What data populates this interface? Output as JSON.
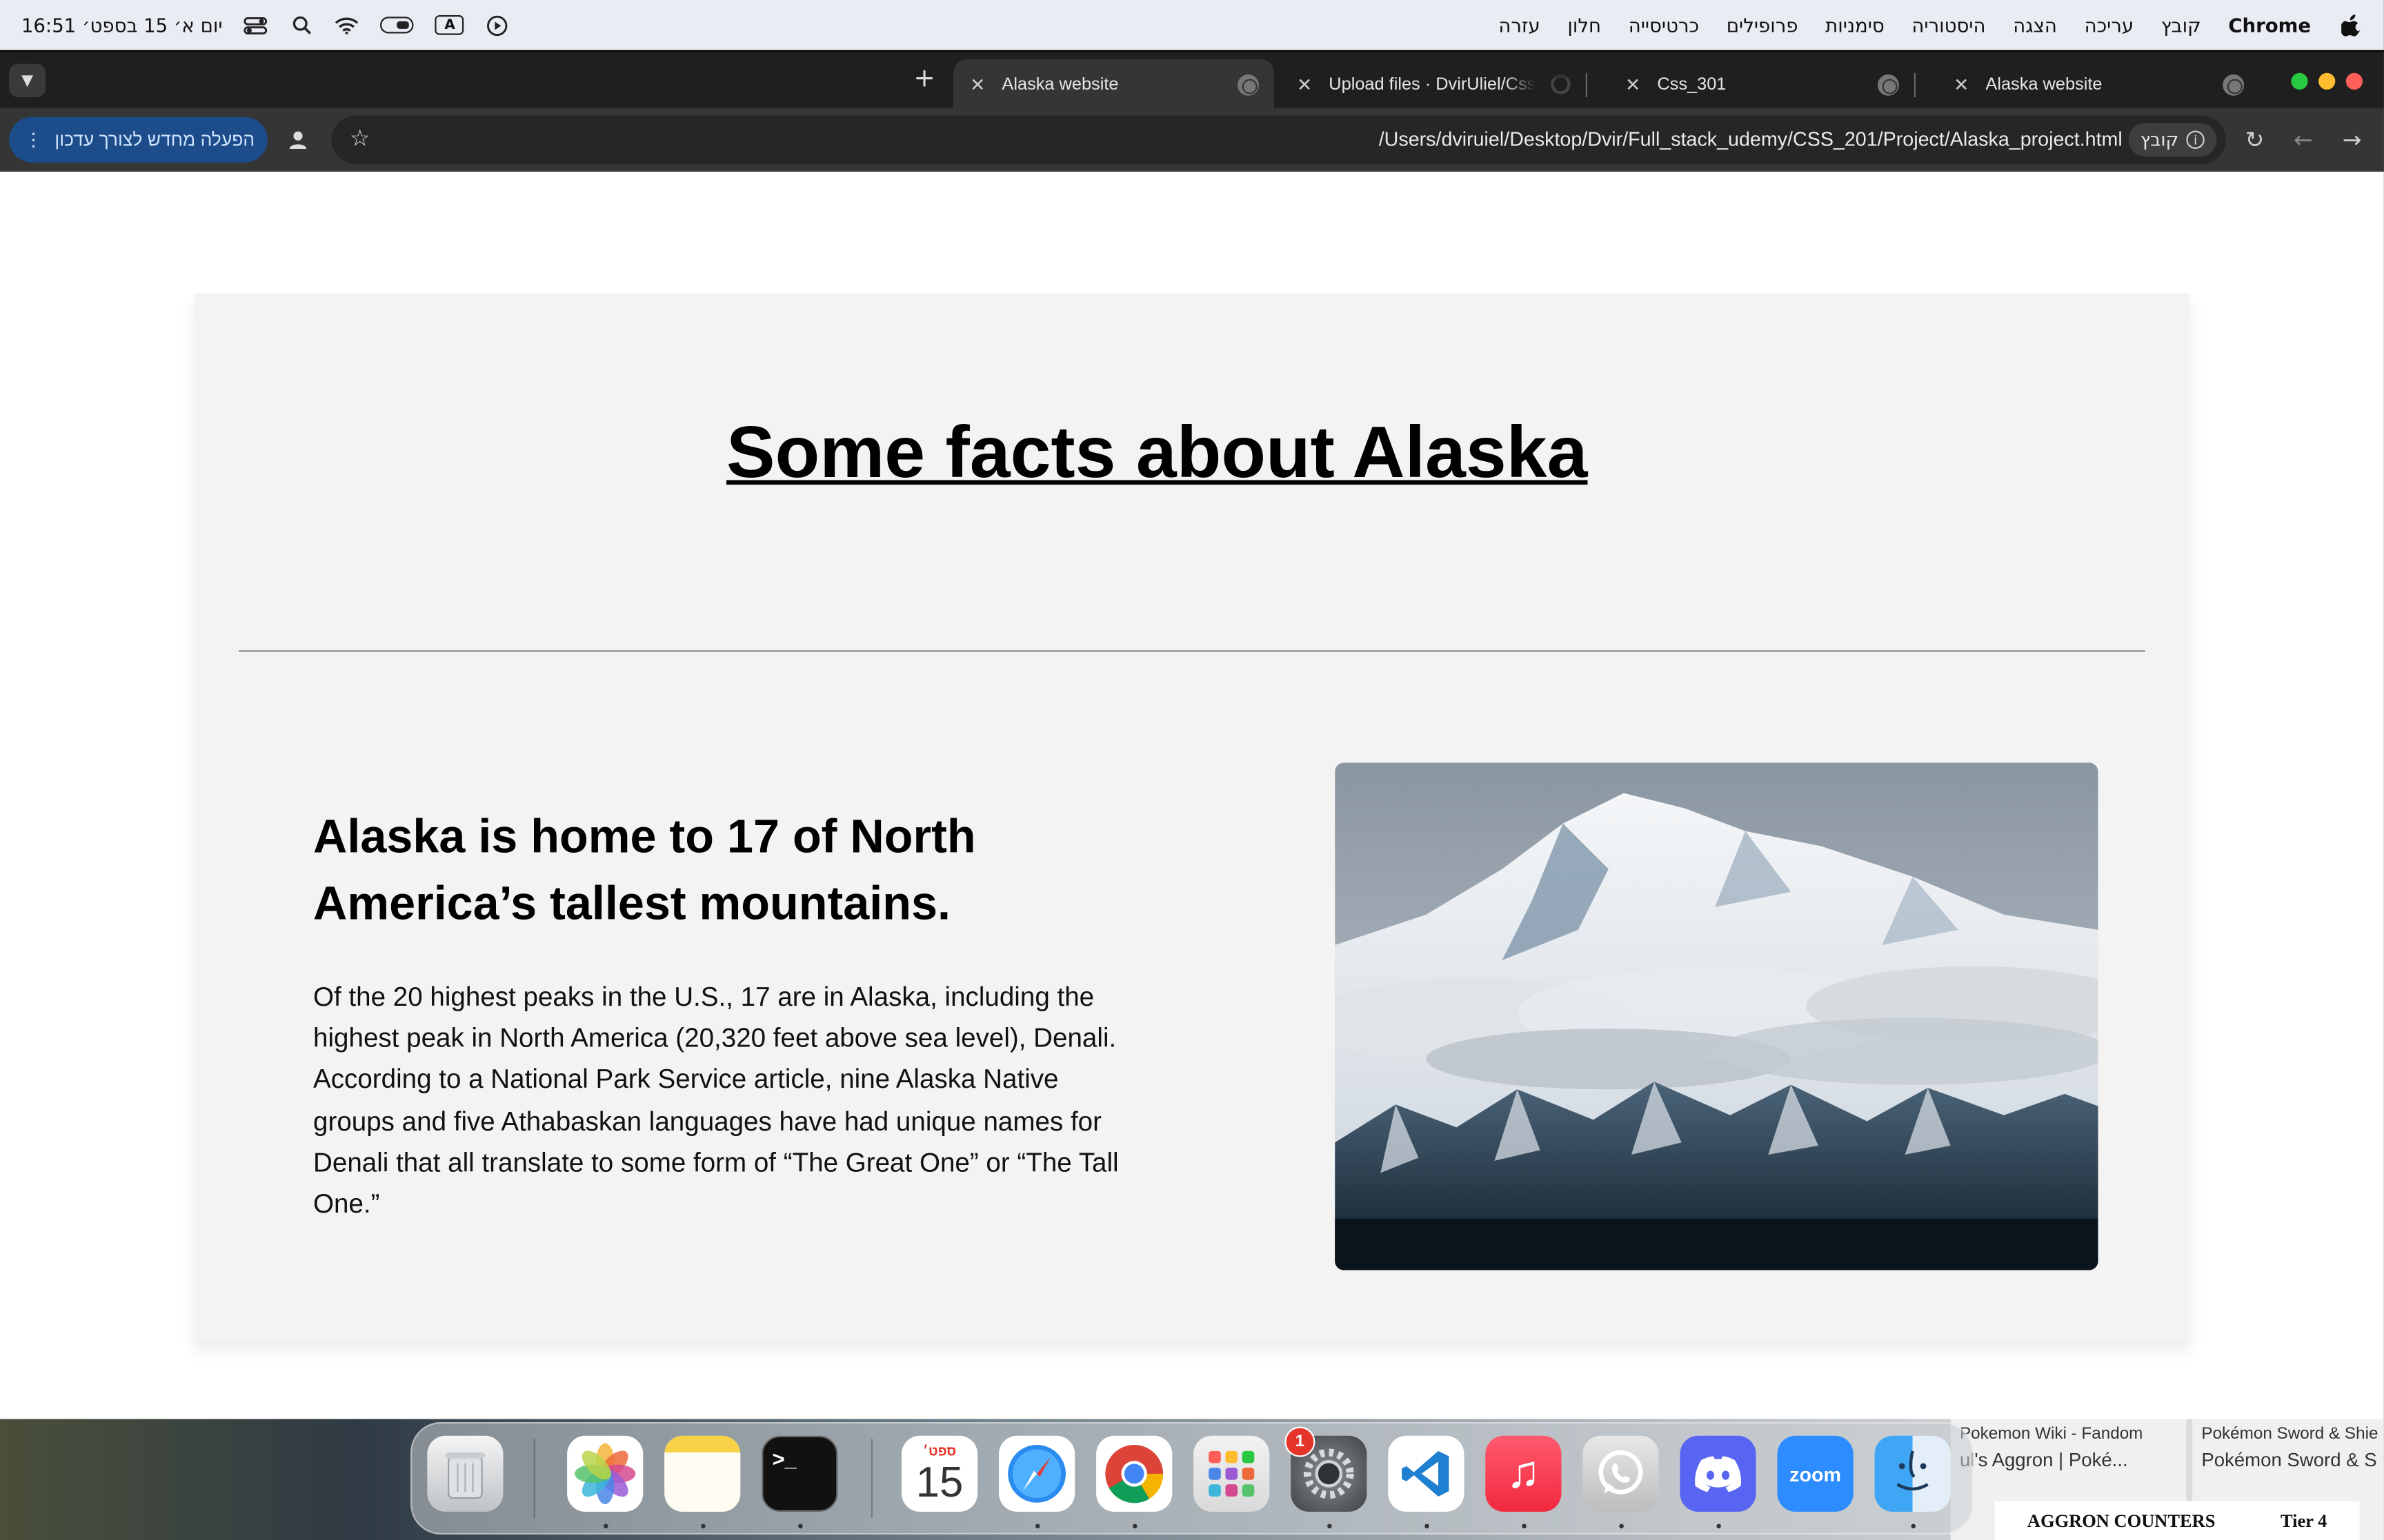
{
  "menubar": {
    "time": "16:51",
    "date": "יום א׳ 15 בספט׳",
    "app": "Chrome",
    "items": [
      "קובץ",
      "עריכה",
      "הצגה",
      "היסטוריה",
      "סימניות",
      "פרופילים",
      "כרטיסייה",
      "חלון",
      "עזרה"
    ],
    "keyboard_indicator": "A"
  },
  "tabs": [
    {
      "title": "Alaska website",
      "active": true
    },
    {
      "title": "Upload files · DvirUliel/Css-se",
      "active": false
    },
    {
      "title": "Css_301",
      "active": false
    },
    {
      "title": "Alaska website",
      "active": false
    }
  ],
  "toolbar": {
    "relaunch_label": "הפעלה מחדש לצורך עדכון",
    "url": "/Users/dviruiel/Desktop/Dvir/Full_stack_udemy/CSS_201/Project/Alaska_project.html",
    "file_chip": "קובץ"
  },
  "page": {
    "title": "Some facts about Alaska",
    "heading": "Alaska is home to 17 of North America’s tallest mountains.",
    "body": "Of the 20 highest peaks in the U.S., 17 are in Alaska, including the highest peak in North America (20,320 feet above sea level), Denali. According to a National Park Service article, nine Alaska Native groups and five Athabaskan languages have had unique names for Denali that all translate to some form of “The Great One” or “The Tall One.”"
  },
  "dock": {
    "calendar_month": "ספט׳",
    "calendar_day": "15",
    "settings_badge": "1",
    "zoom_label": "zoom",
    "terminal_label": ">_"
  },
  "background_windows": {
    "win1_line1": "Pokemon Wiki - Fandom",
    "win1_line2": "ul's Aggron | Poké...",
    "win2_line1": "Pokémon Sword & Shie",
    "win2_line2": "Pokémon Sword & S",
    "aggron_title": "AGGRON COUNTERS",
    "aggron_tier": "Tier 4"
  },
  "colors": {
    "traffic_close": "#ff5f57",
    "traffic_min": "#febc2e",
    "traffic_max": "#28c840",
    "relaunch_bg": "#1c4c8a"
  }
}
